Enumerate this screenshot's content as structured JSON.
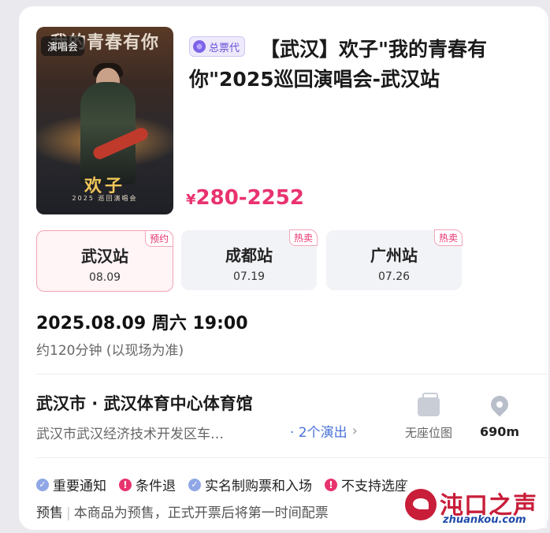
{
  "poster": {
    "tag": "演唱会",
    "title_text": "我的青春有你",
    "artist_text": "欢子",
    "sub_text": "2025 巡回演唱会"
  },
  "event": {
    "agent_badge": "总票代",
    "title": "【武汉】欢子\"我的青春有你\"2025巡回演唱会-武汉站",
    "price_symbol": "¥",
    "price_range": "280-2252"
  },
  "stations": [
    {
      "name": "武汉站",
      "date": "08.09",
      "tag": "预约",
      "active": true
    },
    {
      "name": "成都站",
      "date": "07.19",
      "tag": "热卖",
      "active": false
    },
    {
      "name": "广州站",
      "date": "07.26",
      "tag": "热卖",
      "active": false
    }
  ],
  "schedule": {
    "datetime": "2025.08.09 周六 19:00",
    "duration": "约120分钟 (以现场为准)"
  },
  "venue": {
    "name": "武汉市 · 武汉体育中心体育馆",
    "address": "武汉市武汉经济技术开发区车…",
    "shows_link": "· 2个演出",
    "seatmap_label": "无座位图",
    "distance": "690m"
  },
  "notices": [
    {
      "label": "重要通知",
      "icon": "check-icon",
      "kind": "info"
    },
    {
      "label": "条件退",
      "icon": "alert-icon",
      "kind": "warn"
    },
    {
      "label": "实名制购票和入场",
      "icon": "check-icon",
      "kind": "info"
    },
    {
      "label": "不支持选座",
      "icon": "alert-icon",
      "kind": "warn"
    }
  ],
  "presale": {
    "tag": "预售",
    "text": "本商品为预售，正式开票后将第一时间配票"
  },
  "watermark": {
    "text": "沌口之声",
    "url": "zhuankou.com"
  },
  "colors": {
    "accent": "#e8336e",
    "link": "#4a72d8",
    "agent": "#6a51d6"
  }
}
